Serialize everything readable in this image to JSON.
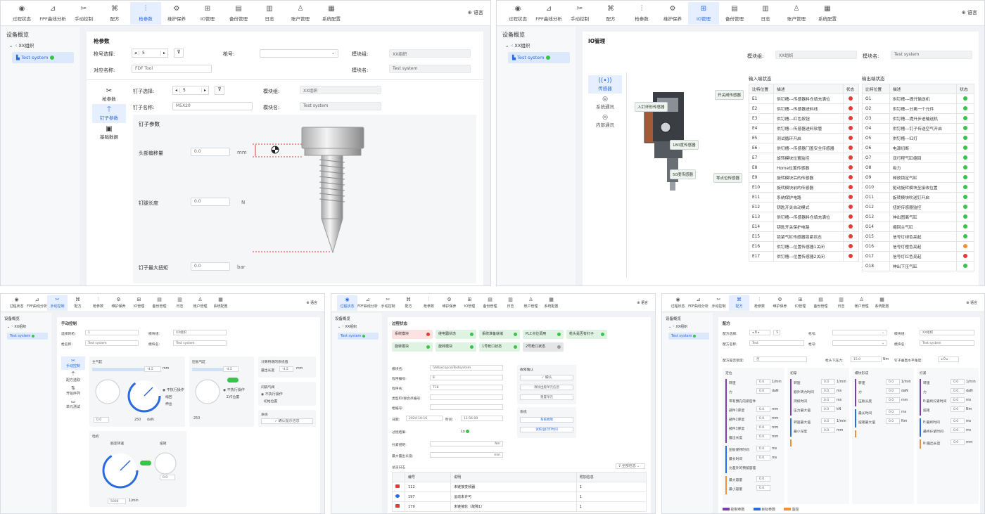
{
  "nav": [
    "过程状态",
    "FPF曲线分析",
    "手动控制",
    "配方",
    "枪参数",
    "维护保养",
    "IO管理",
    "备份管理",
    "日志",
    "账户管理",
    "系统配置"
  ],
  "nav_icons": [
    "status-icon",
    "chart-icon",
    "tool-icon",
    "recipe-icon",
    "sliders-icon",
    "gear-icon",
    "io-icon",
    "backup-icon",
    "log-icon",
    "account-icon",
    "settings-icon"
  ],
  "language": "语言",
  "sidebar": {
    "title": "设备概览",
    "org": "XX组织",
    "system": "Test system"
  },
  "gun": {
    "title": "枪参数",
    "gun_select_label": "枪号选择:",
    "gun_select_value": "5",
    "gun_no_label": "枪号:",
    "module_group_label": "模块组:",
    "module_group_value": "XX组织",
    "module_name_label": "模块名:",
    "module_name_value": "Test system",
    "name_label": "对应名称:",
    "name_value": "FDF Tool",
    "tabs": [
      "枪参数",
      "钉子参数",
      "基础数据"
    ],
    "nail_select_label": "钉子选择:",
    "nail_select_value": "5",
    "nail_name_label": "钉子名称:",
    "nail_name_value": "M5X20",
    "nail_params_title": "钉子参数",
    "head_offset_label": "头部偏移量",
    "head_offset_value": "0.0",
    "head_offset_unit": "mm",
    "leg_length_label": "钉腿长度",
    "leg_length_value": "0.0",
    "leg_length_unit": "N",
    "max_torque_label": "钉子最大扭矩",
    "max_torque_value": "0.0",
    "max_torque_unit": "bar"
  },
  "io": {
    "title": "IO管理",
    "module_group_label": "模块组:",
    "module_group_value": "XX组织",
    "module_name_label": "模块名:",
    "module_name_value": "Test system",
    "tabs": [
      "传感器",
      "系统通讯",
      "内部通讯"
    ],
    "image_tags": [
      "开关阀传感器",
      "入钉环形传感器",
      "180度传感器",
      "50度传感器",
      "零点位传感器"
    ],
    "input_title": "输入端状态",
    "output_title": "输出端状态",
    "headers": [
      "比特位置",
      "描述",
      "状态"
    ],
    "inputs": [
      [
        "E1",
        "供钉槽---传感器料仓填充满位",
        "r"
      ],
      [
        "E2",
        "供钉槽---传感器进料线",
        "r"
      ],
      [
        "E3",
        "供钉槽---红色按钮",
        "r"
      ],
      [
        "E4",
        "供钉槽---传感器进料软管",
        "r"
      ],
      [
        "E5",
        "测试循环开启",
        "r"
      ],
      [
        "E6",
        "供钉槽---传感器门盖安全传感器",
        "r"
      ],
      [
        "E7",
        "旋转模块位置监控",
        "r"
      ],
      [
        "E8",
        "Home位置传感器",
        "r"
      ],
      [
        "E9",
        "旋转模块后的传感器",
        "r"
      ],
      [
        "E10",
        "旋转模块前的传感器",
        "r"
      ],
      [
        "E11",
        "系统保护电路",
        "r"
      ],
      [
        "E12",
        "钥匙开关自动模式",
        "r"
      ],
      [
        "E13",
        "供钉槽---传感器料仓填充满位",
        "r"
      ],
      [
        "E14",
        "钥匙开关保护电路",
        "r"
      ],
      [
        "E15",
        "锁紧气缸传感器锁紧状态",
        "r"
      ],
      [
        "E16",
        "供钉槽---位置传感器1关闭",
        "r"
      ],
      [
        "E17",
        "供钉槽---位置传感器2关闭",
        "r"
      ]
    ],
    "outputs": [
      [
        "O1",
        "供钉槽---提升输送机",
        "g"
      ],
      [
        "O2",
        "供钉槽---分离一个元件",
        "g"
      ],
      [
        "O3",
        "供钉槽---提升步进输送机",
        "g"
      ],
      [
        "O4",
        "供钉槽---钉子传送空气开启",
        "g"
      ],
      [
        "O5",
        "供钉槽---红灯",
        "g"
      ],
      [
        "O6",
        "电源切断",
        "g"
      ],
      [
        "O7",
        "双行程气缸缩回",
        "g"
      ],
      [
        "O8",
        "吸力",
        "g"
      ],
      [
        "O9",
        "释放锁定气缸",
        "g"
      ],
      [
        "O10",
        "驱动旋转模块至接收位置",
        "g"
      ],
      [
        "O11",
        "旋转模块吹送钉开启",
        "g"
      ],
      [
        "O12",
        "扭矩传感器监控",
        "g"
      ],
      [
        "O13",
        "伸出图离气缸",
        "g"
      ],
      [
        "O14",
        "缩回主气缸",
        "g"
      ],
      [
        "O15",
        "信号灯绿色亮起",
        "g"
      ],
      [
        "O16",
        "信号灯橙色亮起",
        "o"
      ],
      [
        "O17",
        "信号灯红色亮起",
        "r"
      ],
      [
        "O18",
        "伸出下压气缸",
        "g"
      ]
    ]
  },
  "manual": {
    "title": "手动控制",
    "selected_gun_label": "选择的枪:",
    "selected_gun_value": "1",
    "gun_name_label": "枪名称:",
    "gun_name_value": "Test system",
    "module_group_label": "模块组:",
    "module_group_value": "XX组织",
    "module_name_label": "模块名:",
    "module_name_value": "Test system",
    "tabs": [
      "手动控制",
      "配方选取",
      "开始序列",
      "单元测试"
    ],
    "main_cyl": "主气缸",
    "press_cyl": "压板气缸",
    "motor": "电机",
    "calc": "计算特增的系统值",
    "calc_label": "露出长度",
    "calc_value": "-4.5",
    "calc_unit": "mm",
    "gas_valve": "间隔气阀",
    "not_exec": "不执行操作",
    "init_pos": "初始位置",
    "system": "系统",
    "confirm_btn": "确认提示信息",
    "pos_value": "-4.5",
    "pos_unit": "mm",
    "opts": [
      "不执行操作",
      "缩回",
      "伸出"
    ],
    "opts2": [
      "不执行操作",
      "工作位置"
    ],
    "pressure": "0.0",
    "rpm": "5000",
    "rpm_unit": "1/min",
    "torque": "0.0",
    "bar": "250",
    "daN": "daN",
    "speed_label": "额定转速",
    "torque_label": "扭矩"
  },
  "process": {
    "title": "过程状态",
    "status_tags": [
      [
        "系统模块",
        "r",
        "red"
      ],
      [
        "继电器状态",
        "g",
        "green"
      ],
      [
        "系统准备就绪",
        "g",
        "green"
      ],
      [
        "PLC点位调用",
        "g",
        "green"
      ],
      [
        "枪头是否有钉子",
        "g",
        "green"
      ],
      [
        "旋转模块",
        "g",
        "green"
      ],
      [
        "旋转模块",
        "g",
        "green"
      ],
      [
        "1号枪口状态",
        "g",
        "green"
      ],
      [
        "2号枪口状态",
        "gr",
        "gray"
      ]
    ],
    "fields": [
      [
        "模块名:",
        "\\\\Atlascopco\\Testsystem"
      ],
      [
        "程序编号:",
        "8"
      ],
      [
        "程序名:",
        "T18"
      ],
      [
        "类型ID/接合点编号:",
        ""
      ],
      [
        "枪编号:",
        ""
      ]
    ],
    "date_label": "日期:",
    "date_value": "2024-10-16",
    "time_label": "时间:",
    "time_value": "11:56:00",
    "result_label": "过程结果:",
    "result_value": "Lo",
    "final_torque_label": "拧紧扭矩:",
    "final_torque_unit": "Nm",
    "max_len_label": "最大露出长度:",
    "max_len_unit": "mm",
    "confirm_title": "故障确认",
    "confirm_btn": "确认",
    "fault_btn": "清除出版单元信息",
    "fault_btn2": "重置单元",
    "sys_title": "系统",
    "sys_btn1": "系统故障",
    "sys_btn2": "试校准打印时间",
    "log_title": "总览日志",
    "log_filter": "全部信息",
    "log_headers": [
      "编号",
      "说明",
      "附加信息"
    ],
    "logs": [
      [
        "112",
        "未链接变频器",
        "1",
        "red"
      ],
      [
        "197",
        "运动未许可",
        "1",
        "blue"
      ],
      [
        "179",
        "未链接轮（故障1）",
        "1",
        "red"
      ]
    ]
  },
  "recipe": {
    "title": "配方",
    "recipe_select_label": "配方选择:",
    "recipe_select_value": "8",
    "gun_no_label": "枪号:",
    "module_group_label": "模块组:",
    "module_group_value": "XX组织",
    "name_label": "配方名称:",
    "name_value": "Test",
    "module_name_label": "模块名:",
    "module_name_value": "Test system",
    "locked_label": "配方是否锁定:",
    "locked_value": "否",
    "press_label": "枪头下压力:",
    "press_value": "15.0",
    "press_unit": "Nm",
    "angle_label": "钉子垂直水平角度:",
    "angle_value": "0",
    "cols": [
      "定位",
      "初穿",
      "螺纹形成",
      "拧紧"
    ],
    "legend": [
      "控制参数",
      "目标参数",
      "监控"
    ],
    "rows_a": [
      [
        "转速",
        "0.0",
        "1/min"
      ],
      [
        "力",
        "0.0",
        "daN"
      ],
      [
        "带有预孔的紧密件",
        ""
      ],
      [
        "部件1厚度",
        "0.0",
        "mm"
      ],
      [
        "部件2厚度",
        "0.0",
        "mm"
      ],
      [
        "部件3厚度",
        "0.0",
        "mm"
      ],
      [
        "露出长度",
        "0.0",
        "mm"
      ],
      [
        "压板保持时间",
        "0.0",
        "ms"
      ],
      [
        "最长时间",
        "0.0",
        "ms"
      ],
      [
        "允差外的预留容差",
        ""
      ],
      [
        "最大容量",
        "0.0",
        ""
      ],
      [
        "最小容量",
        "0.0",
        ""
      ]
    ],
    "rows_b": [
      [
        "转速",
        "0.0",
        "1/min"
      ],
      [
        "额外转力时间",
        "0.0",
        "ms"
      ],
      [
        "持续时间",
        "0.0",
        "ms"
      ],
      [
        "压力最大值",
        "0.0",
        "kN"
      ],
      [
        "转速最大值",
        "0.0",
        "1/min"
      ],
      [
        "最小深度",
        "0.0",
        "mm"
      ]
    ],
    "rows_c": [
      [
        "转速",
        "0.0",
        "1/min"
      ],
      [
        "力",
        "0.0",
        "daN"
      ],
      [
        "压板长度",
        "0.0",
        "mm"
      ],
      [
        "最长时间",
        "0.0",
        "ms"
      ],
      [
        "扭矩最大值",
        "0.0",
        "Nm"
      ]
    ],
    "rows_d": [
      [
        "转速",
        "0.0",
        "1/min"
      ],
      [
        "力",
        "0.0",
        "daN"
      ],
      [
        "E:最终拧紧时间",
        "0.0",
        "ms"
      ],
      [
        "扭矩",
        "0.0",
        "Nm"
      ],
      [
        "E:最终时间",
        "0.0",
        "ms"
      ],
      [
        "最终拧紧时间",
        "0.0",
        "ms"
      ],
      [
        "N:露出长度",
        "0.0",
        "mm"
      ]
    ]
  }
}
